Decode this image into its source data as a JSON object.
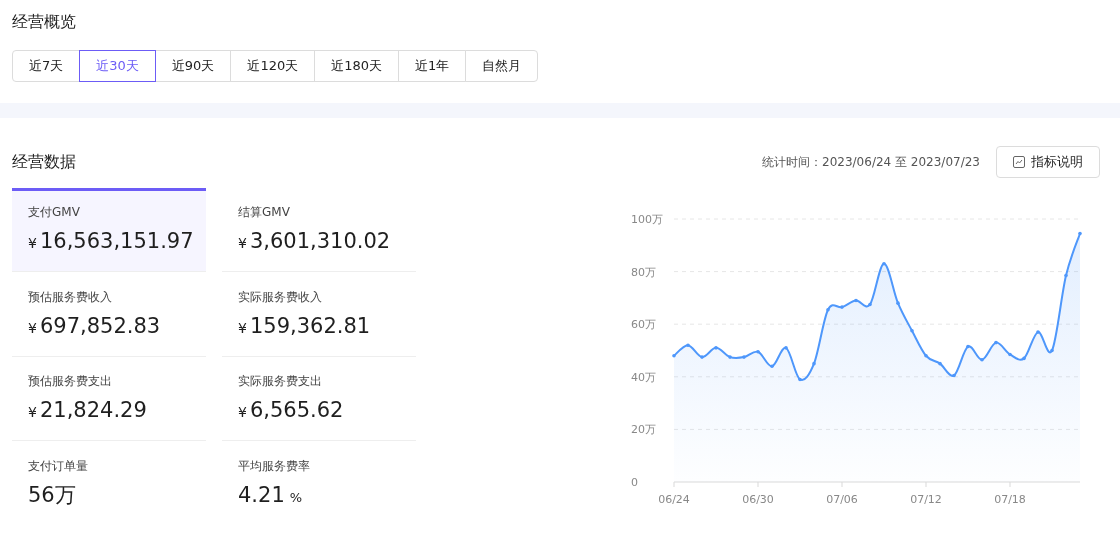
{
  "overview": {
    "title": "经营概览",
    "tabs": [
      {
        "label": "近7天",
        "selected": false
      },
      {
        "label": "近30天",
        "selected": true
      },
      {
        "label": "近90天",
        "selected": false
      },
      {
        "label": "近120天",
        "selected": false
      },
      {
        "label": "近180天",
        "selected": false
      },
      {
        "label": "近1年",
        "selected": false
      },
      {
        "label": "自然月",
        "selected": false
      }
    ]
  },
  "data_section": {
    "title": "经营数据",
    "stat_time": "统计时间：2023/06/24 至 2023/07/23",
    "help_button": "指标说明",
    "metrics": [
      {
        "label": "支付GMV",
        "prefix": "¥",
        "value": "16,563,151.97",
        "selected": true
      },
      {
        "label": "结算GMV",
        "prefix": "¥",
        "value": "3,601,310.02",
        "selected": false
      },
      {
        "label": "预估服务费收入",
        "prefix": "¥",
        "value": "697,852.83",
        "selected": false
      },
      {
        "label": "实际服务费收入",
        "prefix": "¥",
        "value": "159,362.81",
        "selected": false
      },
      {
        "label": "预估服务费支出",
        "prefix": "¥",
        "value": "21,824.29",
        "selected": false
      },
      {
        "label": "实际服务费支出",
        "prefix": "¥",
        "value": "6,565.62",
        "selected": false
      },
      {
        "label": "支付订单量",
        "value": "56万",
        "selected": false
      },
      {
        "label": "平均服务费率",
        "value": "4.21",
        "suffix": "%",
        "selected": false
      }
    ],
    "chart_data": {
      "type": "area",
      "categories": [
        "06/24",
        null,
        null,
        null,
        null,
        null,
        "06/30",
        null,
        null,
        null,
        null,
        null,
        "07/06",
        null,
        null,
        null,
        null,
        null,
        "07/12",
        null,
        null,
        null,
        null,
        null,
        "07/18",
        null,
        null,
        null,
        null,
        null
      ],
      "grid": true,
      "series": [
        {
          "color": "#4e97fb",
          "values": [
            48,
            52,
            47.5,
            51,
            47.5,
            47.5,
            49.5,
            44,
            51,
            39,
            45,
            65.5,
            66.5,
            69,
            67.5,
            83,
            68,
            57.5,
            48,
            45,
            40.5,
            51.5,
            46.5,
            53,
            48.5,
            47,
            57,
            50,
            78.5,
            94.5
          ]
        }
      ],
      "yticks": [
        {
          "value": 0,
          "label": "0"
        },
        {
          "value": 20,
          "label": "20万"
        },
        {
          "value": 40,
          "label": "40万"
        },
        {
          "value": 60,
          "label": "60万"
        },
        {
          "value": 80,
          "label": "80万"
        },
        {
          "value": 100,
          "label": "100万"
        }
      ],
      "ylim": [
        0,
        100
      ]
    }
  }
}
